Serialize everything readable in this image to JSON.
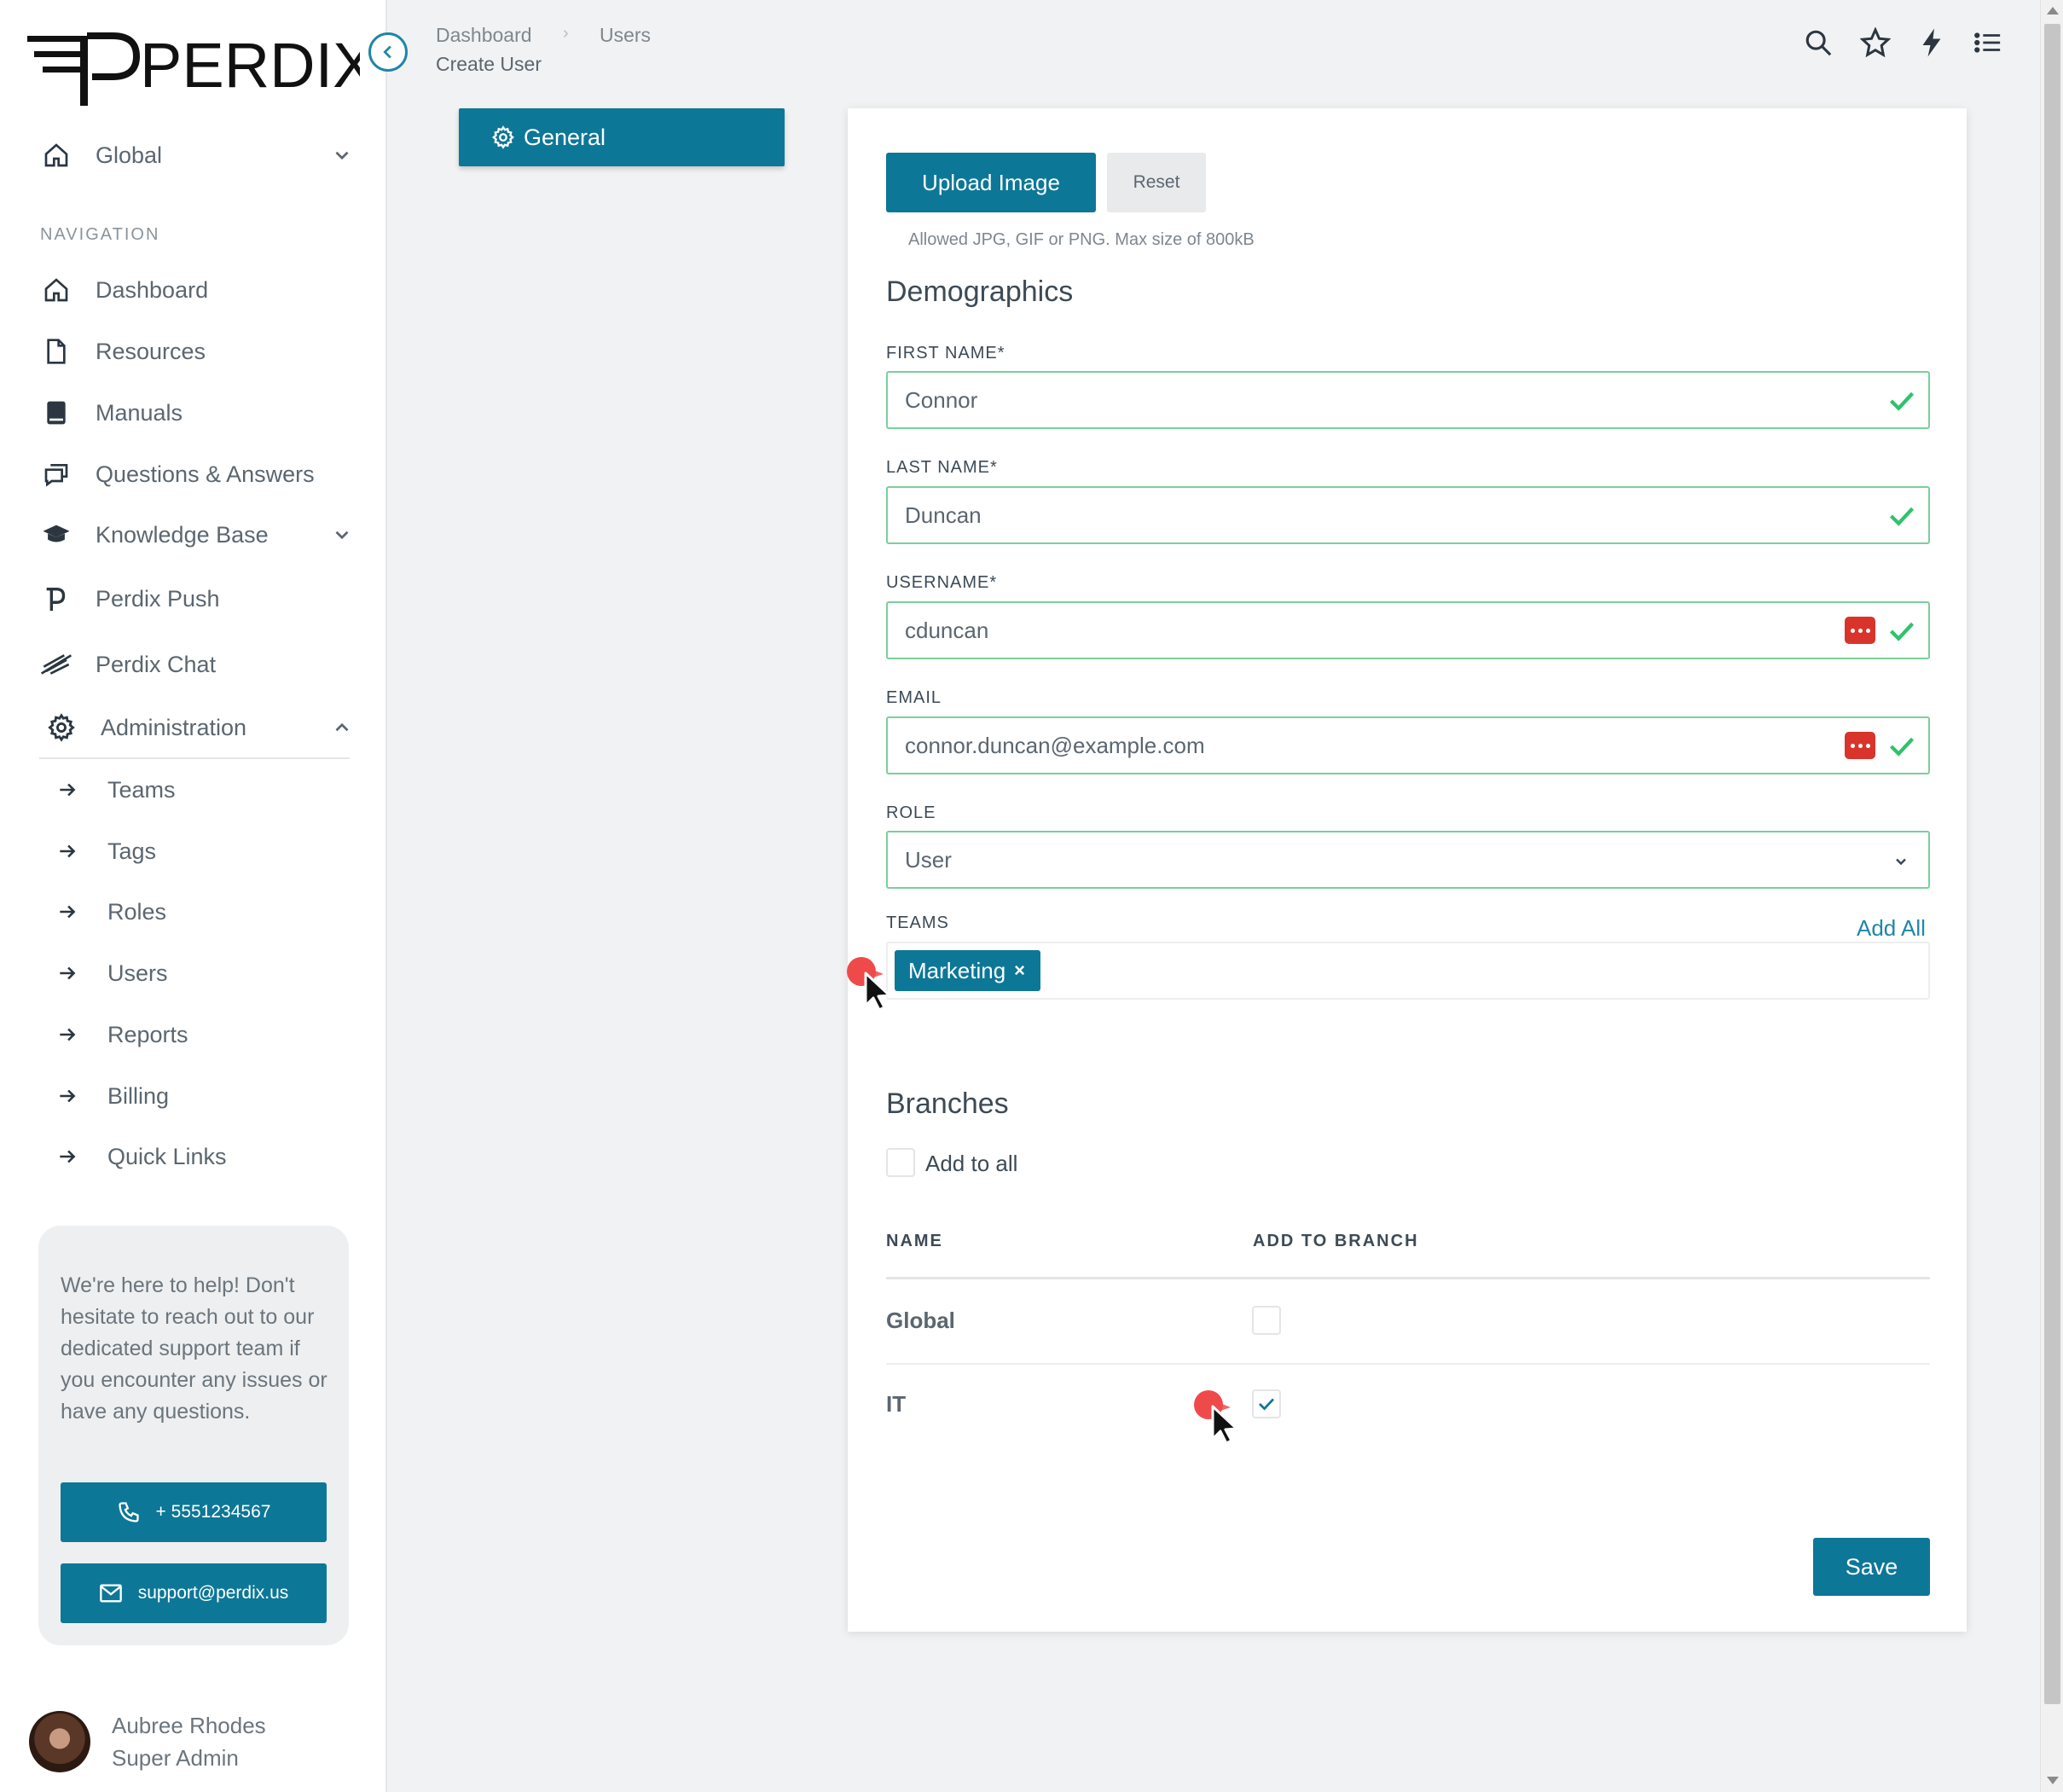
{
  "brand": {
    "name": "PERDIX",
    "accent": "#0d7797",
    "valid": "#2ec36b",
    "danger": "#d9342b"
  },
  "sidebar": {
    "scope_selector": {
      "label": "Global",
      "icon": "home-icon"
    },
    "nav_heading": "NAVIGATION",
    "items": [
      {
        "label": "Dashboard",
        "icon": "home-icon"
      },
      {
        "label": "Resources",
        "icon": "file-icon"
      },
      {
        "label": "Manuals",
        "icon": "book-icon"
      },
      {
        "label": "Questions & Answers",
        "icon": "chat-icon"
      },
      {
        "label": "Knowledge Base",
        "icon": "graduation-cap-icon"
      },
      {
        "label": "Perdix Push",
        "icon": "perdix-p-icon"
      },
      {
        "label": "Perdix Chat",
        "icon": "bird-icon"
      },
      {
        "label": "Administration",
        "icon": "gear-icon"
      }
    ],
    "admin_subitems": [
      "Teams",
      "Tags",
      "Roles",
      "Users",
      "Reports",
      "Billing",
      "Quick Links"
    ],
    "support": {
      "text": "We're here to help! Don't hesitate to reach out to our dedicated support team if you encounter any issues or have any questions.",
      "phone": "+ 5551234567",
      "email": "support@perdix.us"
    },
    "user": {
      "name": "Aubree Rhodes",
      "role": "Super Admin"
    }
  },
  "header": {
    "breadcrumb": [
      "Dashboard",
      "Users"
    ],
    "breadcrumb_separator": "›",
    "page_title": "Create User",
    "icons": [
      "search-icon",
      "star-icon",
      "lightning-icon",
      "list-icon"
    ]
  },
  "tabs": [
    {
      "label": "General",
      "icon": "gear-icon"
    }
  ],
  "form": {
    "upload_label": "Upload Image",
    "reset_label": "Reset",
    "upload_hint": "Allowed JPG, GIF or PNG. Max size of 800kB",
    "demographics_title": "Demographics",
    "first_name": {
      "label": "FIRST NAME*",
      "value": "Connor"
    },
    "last_name": {
      "label": "LAST NAME*",
      "value": "Duncan"
    },
    "username": {
      "label": "USERNAME*",
      "value": "cduncan"
    },
    "email": {
      "label": "EMAIL",
      "value": "connor.duncan@example.com"
    },
    "role": {
      "label": "ROLE",
      "value": "User"
    },
    "teams": {
      "label": "TEAMS",
      "add_all": "Add All",
      "selected": "Marketing",
      "remove": "×"
    },
    "branches": {
      "title": "Branches",
      "add_to_all": "Add to all",
      "col_name": "NAME",
      "col_add": "ADD TO BRANCH",
      "rows": [
        {
          "name": "Global",
          "checked": false
        },
        {
          "name": "IT",
          "checked": true
        }
      ]
    },
    "save_label": "Save"
  }
}
